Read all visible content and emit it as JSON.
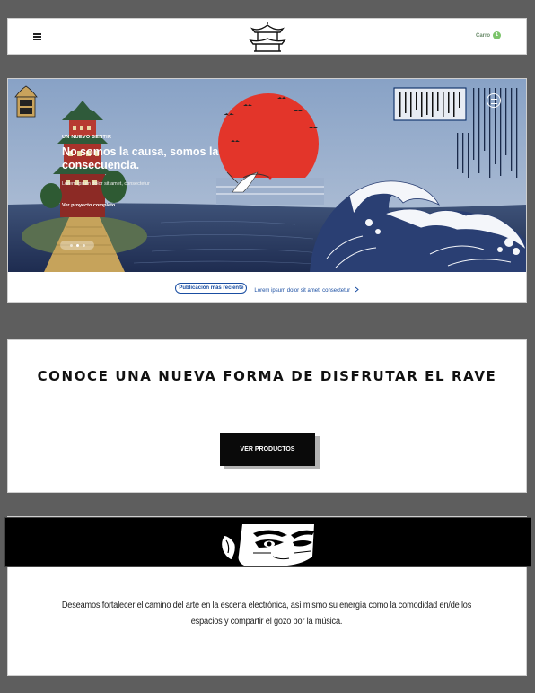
{
  "header": {
    "menu_icon": "hamburger-menu-icon",
    "logo_icon": "pagoda-logo-icon",
    "cart_label": "Carro",
    "cart_count": "1"
  },
  "hero": {
    "kicker": "UN NUEVO SENTIR",
    "title": "No somos la causa, somos la consecuencia.",
    "subtitle": "Lorem ipsum dolor sit amet, consectetur",
    "link": "Ver proyecto completo",
    "close_icon": "close-circle-icon",
    "badge_icon": "pagoda-badge-icon",
    "slides_total": 3,
    "slide_active": 2
  },
  "latest": {
    "pill": "Publicación más reciente",
    "text": "Lorem ipsum dolor sit amet, consectetur",
    "arrow_icon": "chevron-right-icon"
  },
  "promo": {
    "title": "Conoce una nueva forma de disfrutar el rave",
    "button": "VER PRODUCTOS"
  },
  "mission": {
    "banner_icon": "manga-eyes-illustration",
    "text": "Deseamos fortalecer el camino del arte en la escena electrónica, así mismo su energía como la comodidad en/de los espacios y compartir el gozo por la música."
  },
  "colors": {
    "background": "#5e5e5e",
    "accent_blue": "#1a4ea2",
    "sun_red": "#e3352a",
    "button_black": "#0a0a0a"
  }
}
